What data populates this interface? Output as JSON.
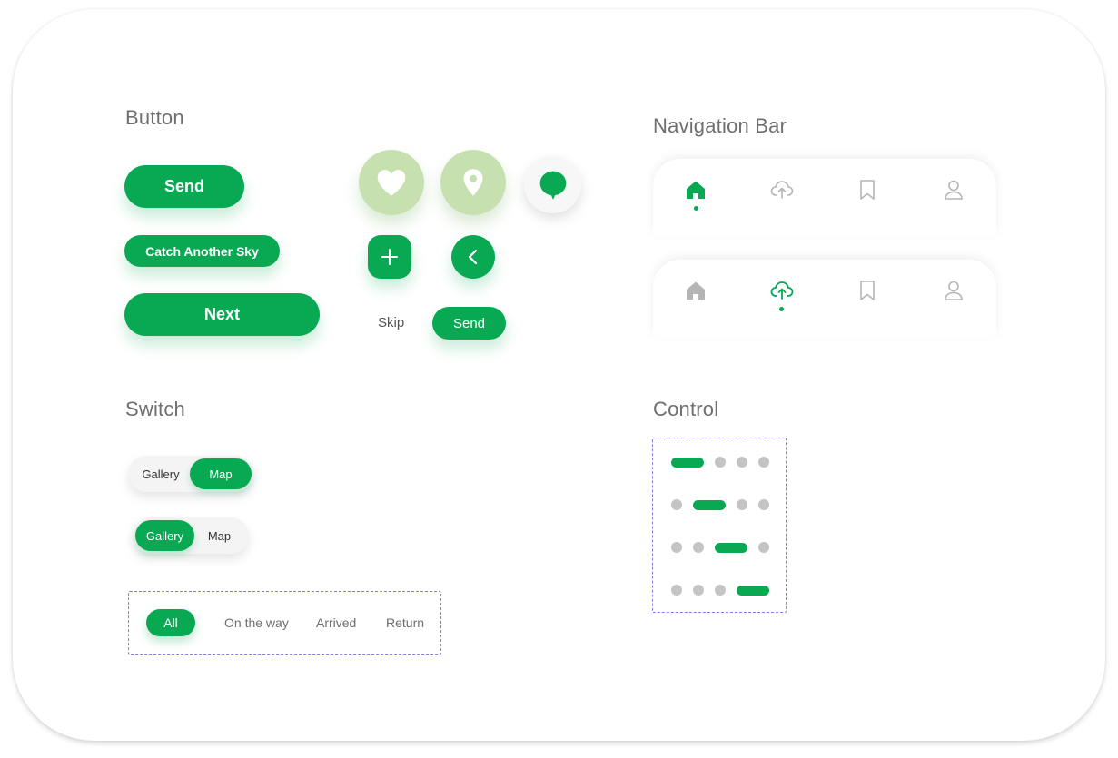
{
  "sections": {
    "button": "Button",
    "navigation": "Navigation Bar",
    "switch": "Switch",
    "control": "Control"
  },
  "buttons": {
    "send": "Send",
    "catch": "Catch Another Sky",
    "next": "Next",
    "skip": "Skip",
    "send_small": "Send"
  },
  "icons": {
    "heart": "heart-icon",
    "location": "location-pin-icon",
    "chat": "chat-bubble-icon",
    "plus": "plus-icon",
    "back": "chevron-left-icon"
  },
  "nav_bars": [
    {
      "active": "home",
      "items": [
        "home-icon",
        "cloud-upload-icon",
        "bookmark-icon",
        "user-icon"
      ]
    },
    {
      "active": "cloud-upload",
      "items": [
        "home-icon",
        "cloud-upload-icon",
        "bookmark-icon",
        "user-icon"
      ]
    }
  ],
  "switches": [
    {
      "left": "Gallery",
      "right": "Map",
      "selected": "Map"
    },
    {
      "left": "Gallery",
      "right": "Map",
      "selected": "Gallery"
    }
  ],
  "tabs": {
    "items": [
      "All",
      "On the way",
      "Arrived",
      "Return"
    ],
    "selected": "All"
  },
  "control": {
    "pages": 4,
    "active_rows": [
      1,
      2,
      3,
      4
    ]
  },
  "colors": {
    "primary": "#09a954",
    "primary_light": "#c6e0b0",
    "inactive_icon": "#b5b5b5",
    "title": "#6f6f6f",
    "dashed_border": "#8a79e6"
  }
}
